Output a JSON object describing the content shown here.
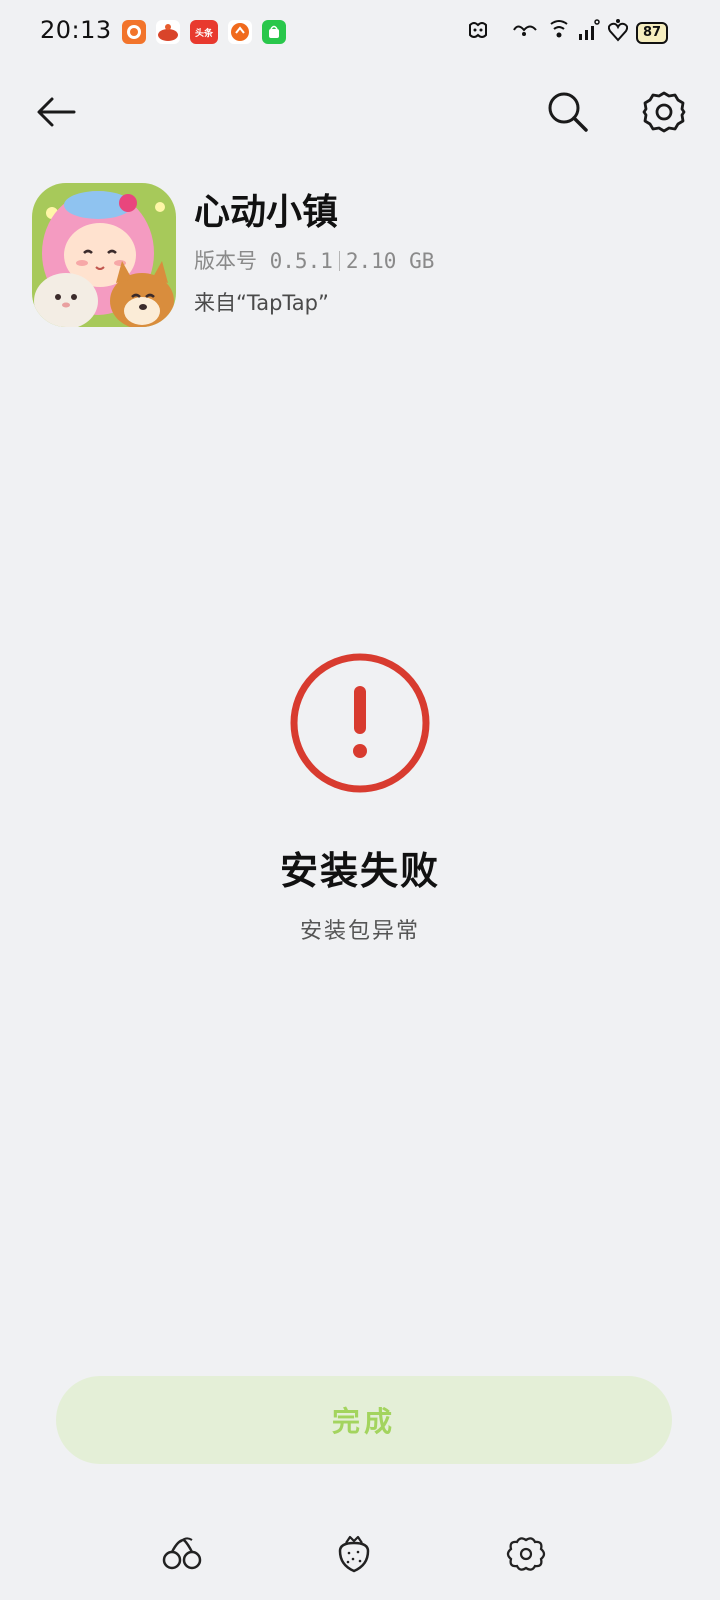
{
  "status_bar": {
    "time": "20:13",
    "battery": "87",
    "notification_icons": [
      "app-icon-1",
      "app-icon-2",
      "toutiao-icon",
      "app-icon-4",
      "store-icon"
    ],
    "notif_toutiao_text": "头条"
  },
  "top_bar": {
    "back_icon": "arrow-left-icon",
    "search_icon": "search-icon",
    "settings_icon": "gear-icon"
  },
  "app": {
    "name": "心动小镇",
    "version": "版本号 0.5.1",
    "size": "2.10 GB",
    "source": "来自“TapTap”"
  },
  "result": {
    "title": "安装失败",
    "subtitle": "安装包异常",
    "status_color": "#d83b2f"
  },
  "actions": {
    "done_label": "完成",
    "done_text_color": "#a3d45e",
    "done_bg_color": "#e4efd7"
  },
  "bottom_nav": {
    "back_icon": "cherry-icon",
    "home_icon": "strawberry-icon",
    "recent_icon": "flower-icon"
  }
}
